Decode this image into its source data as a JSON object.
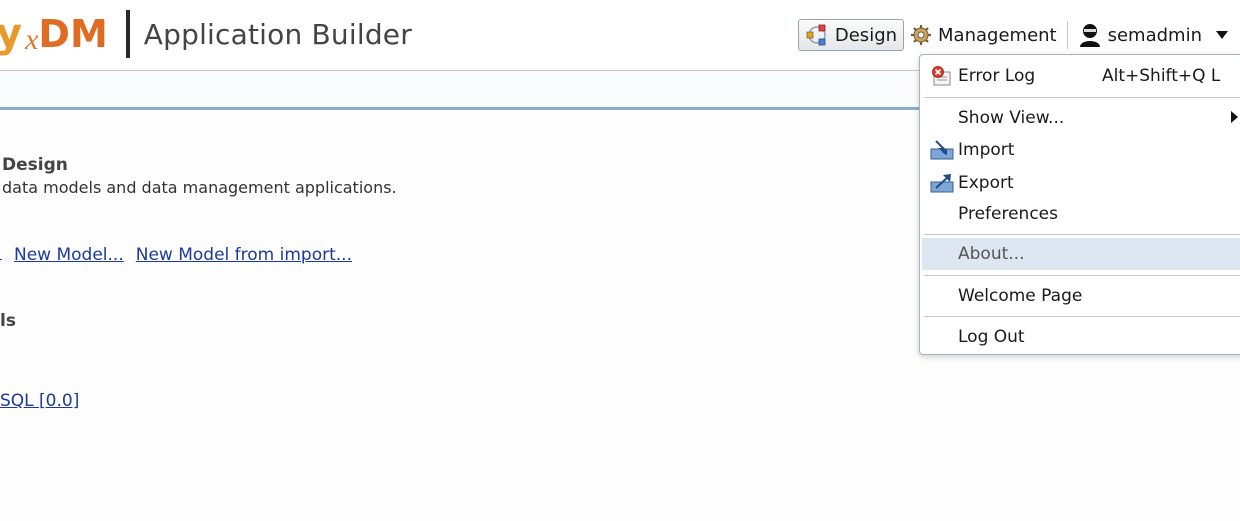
{
  "header": {
    "logo": {
      "part_y": "y",
      "part_x": "x",
      "part_dm": "DM"
    },
    "app_title": "Application Builder",
    "nav": {
      "design_label": "Design",
      "management_label": "Management",
      "user_label": "semadmin"
    }
  },
  "main": {
    "section_title": "Design",
    "section_description": "data models and data management applications.",
    "links": [
      "New Model...",
      "New Model from import..."
    ],
    "section2_title": "ls",
    "sql_link": "SQL [0.0]"
  },
  "menu": {
    "items": [
      {
        "label": "Error Log",
        "accelerator": "Alt+Shift+Q L",
        "icon": "error-log-icon"
      },
      {
        "label": "Show View...",
        "submenu": true
      },
      {
        "label": "Import",
        "icon": "import-icon"
      },
      {
        "label": "Export",
        "icon": "export-icon"
      },
      {
        "label": "Preferences"
      },
      {
        "label": "About...",
        "highlighted": true
      },
      {
        "label": "Welcome Page"
      },
      {
        "label": "Log Out"
      }
    ]
  },
  "colors": {
    "logo_orange": "#e06b22",
    "link_blue": "#1a3aa0",
    "menu_highlight": "#dde6f1",
    "search_border_accent": "#8aaed0"
  }
}
